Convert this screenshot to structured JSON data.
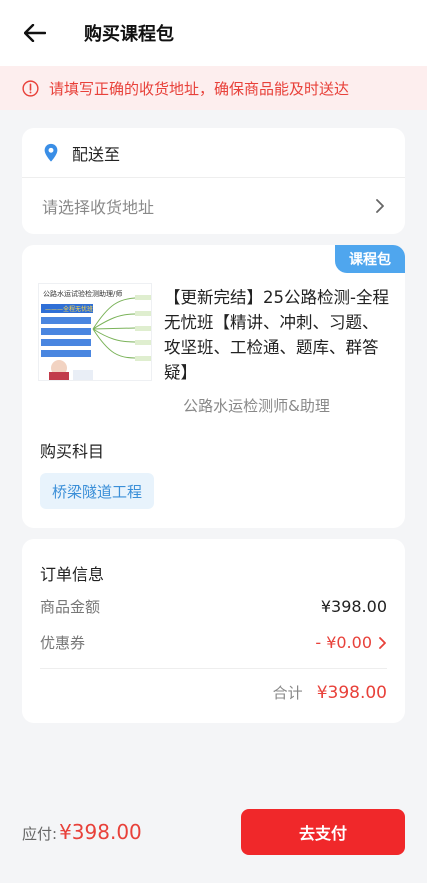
{
  "header": {
    "title": "购买课程包"
  },
  "notice": {
    "text": "请填写正确的收货地址，确保商品能及时送达"
  },
  "address": {
    "label": "配送至",
    "placeholder": "请选择收货地址"
  },
  "course": {
    "badge": "课程包",
    "title": "【更新完结】25公路检测-全程无忧班【精讲、冲刺、习题、攻坚班、工检通、题库、群答疑】",
    "subtitle": "公路水运检测师&助理",
    "subject_label": "购买科目",
    "subject_chip": "桥梁隧道工程",
    "thumb_text": "公路水运试验检测助理/师",
    "thumb_accent": "#2f6fd6"
  },
  "order": {
    "title": "订单信息",
    "rows": [
      {
        "key": "商品金额",
        "value": "¥398.00"
      },
      {
        "key": "优惠券",
        "value": "- ¥0.00"
      }
    ],
    "total_label": "合计",
    "total_value": "¥398.00"
  },
  "footer": {
    "pay_label": "应付:",
    "pay_value": "¥398.00",
    "button": "去支付"
  },
  "colors": {
    "accent_red": "#e8413a",
    "badge_blue": "#4fa6ee",
    "button_red": "#f0282a"
  }
}
